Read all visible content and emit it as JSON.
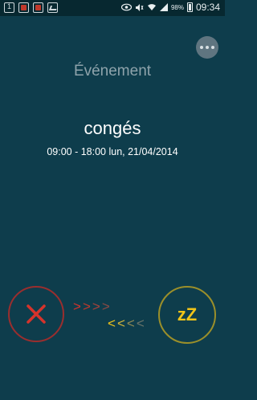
{
  "statusbar": {
    "battery": "98%",
    "time": "09:34"
  },
  "event": {
    "header": "Événement",
    "title": "congés",
    "time": "09:00 - 18:00 lun, 21/04/2014"
  },
  "actions": {
    "snooze_label": "zZ",
    "dismiss_icon": "close-icon",
    "more_icon": "more-horizontal-icon"
  },
  "colors": {
    "background": "#0e3d4c",
    "dismiss": "#c0392b",
    "snooze": "#f0c419"
  }
}
